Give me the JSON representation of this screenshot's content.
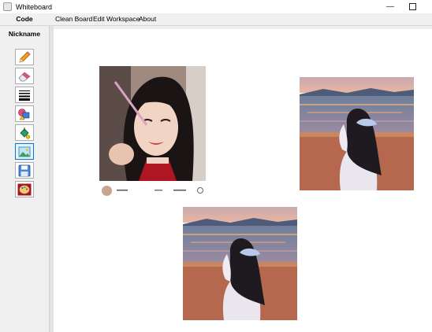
{
  "window": {
    "title": "Whiteboard"
  },
  "menu": {
    "code_label": "Code",
    "items": [
      "Clean Board",
      "Edit Workspace",
      "About"
    ]
  },
  "sidebar": {
    "nickname_label": "Nickname",
    "tools": [
      {
        "icon": "pencil-icon",
        "selected": false
      },
      {
        "icon": "eraser-icon",
        "selected": false
      },
      {
        "icon": "line-width-icon",
        "selected": false
      },
      {
        "icon": "shapes-icon",
        "selected": false
      },
      {
        "icon": "color-fill-icon",
        "selected": false
      },
      {
        "icon": "image-icon",
        "selected": true
      },
      {
        "icon": "save-icon",
        "selected": false
      },
      {
        "icon": "palette-icon",
        "selected": false
      }
    ]
  },
  "canvas": {
    "images": [
      {
        "kind": "photo",
        "subject": "girl-makeup-photo"
      },
      {
        "kind": "illustration",
        "subject": "girl-beach-sunset"
      },
      {
        "kind": "illustration",
        "subject": "girl-beach-sunset"
      }
    ]
  },
  "colors": {
    "accent": "#0078d7",
    "window_bg": "#f0f0f0",
    "canvas_bg": "#ffffff"
  }
}
